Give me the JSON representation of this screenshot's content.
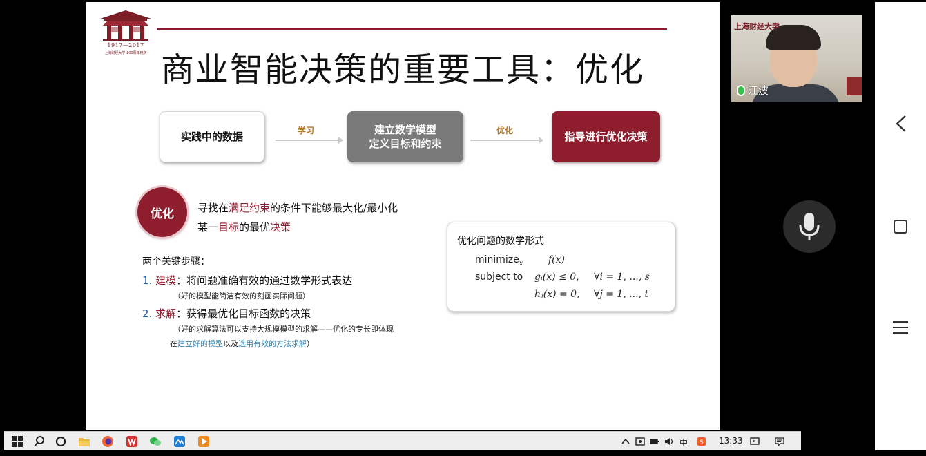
{
  "slide": {
    "logo_years": "1917—2017",
    "logo_caption": "上海财经大学 100周年校庆",
    "title": "商业智能决策的重要工具：优化",
    "flow": {
      "box1": "实践中的数据",
      "arrow1": "学习",
      "box2_line1": "建立数学模型",
      "box2_line2": "定义目标和约束",
      "arrow2": "优化",
      "box3": "指导进行优化决策"
    },
    "badge": "优化",
    "desc": {
      "l1_a": "寻找在",
      "l1_b": "满足约束",
      "l1_c": "的条件下能够最大化/最小化",
      "l2_a": "某一",
      "l2_b": "目标",
      "l2_c": "的最优",
      "l2_d": "决策"
    },
    "steps_heading": "两个关键步骤：",
    "step1": {
      "num": "1. ",
      "name": "建模",
      "text": "：将问题准确有效的通过数学形式表达"
    },
    "note1": "（好的模型能简洁有效的刻画实际问题）",
    "step2": {
      "num": "2. ",
      "name": "求解",
      "text": "：获得最优化目标函数的决策"
    },
    "note2": {
      "a": "（好的求解算法可以支持大规模模型的求解——优化的专长即体现",
      "b1": "在",
      "b2": "建立好的模型",
      "b3": "以及",
      "b4": "选用有效的方法求解",
      "b5": "）"
    },
    "math": {
      "heading": "优化问题的数学形式",
      "minimize": "minimize",
      "min_sub": "x",
      "objective": "f(x)",
      "subject_to": "subject to",
      "c1": "gᵢ(x) ≤ 0,",
      "c1_q": "∀i = 1, ..., s",
      "c2": "hⱼ(x) = 0,",
      "c2_q": "∀j = 1, ..., t"
    }
  },
  "video": {
    "logo": "上海财经大学",
    "name": "江波"
  },
  "taskbar": {
    "time": "13:33",
    "ime": "中",
    "icons": [
      "windows-start-icon",
      "search-icon",
      "cortana-icon",
      "file-explorer-icon",
      "firefox-icon",
      "wps-icon",
      "wechat-icon",
      "app-icon",
      "video-player-icon"
    ]
  },
  "colors": {
    "accent": "#8e1d2e",
    "gray_box": "#7a7a7a",
    "arrow_label": "#b8772a",
    "link_blue": "#2f86b5"
  }
}
